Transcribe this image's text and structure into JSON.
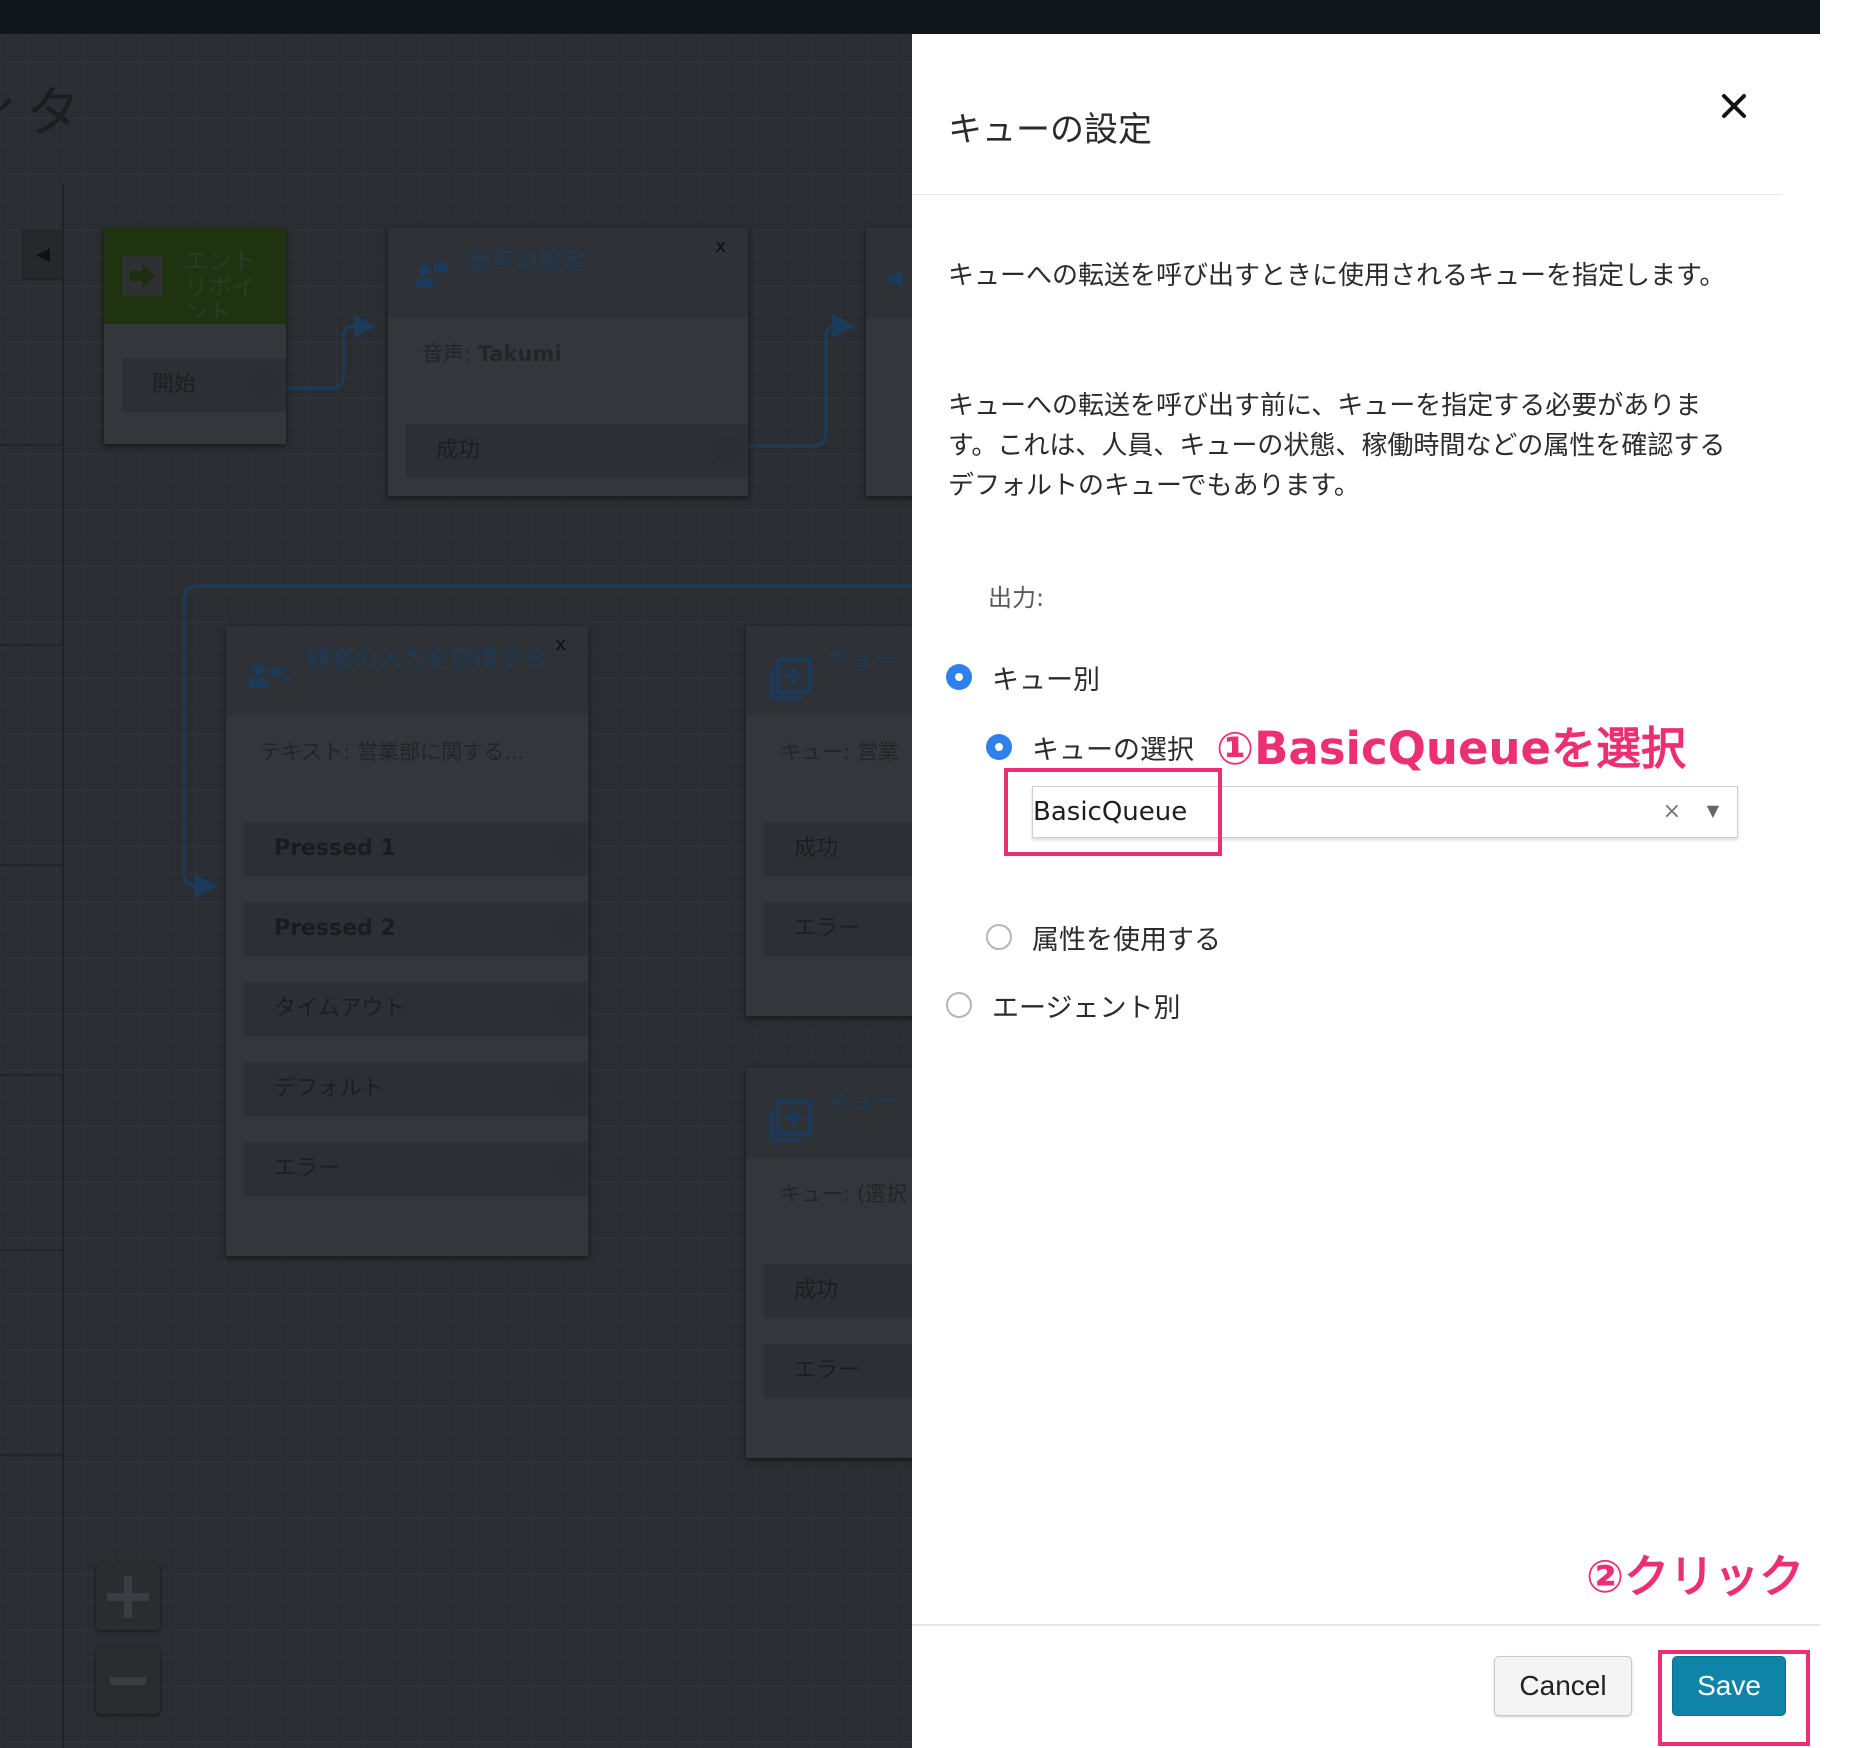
{
  "canvas": {
    "title_fragment": "ィタ",
    "blocks": {
      "entry": {
        "title": "エントリポイント",
        "branch": "開始"
      },
      "voice": {
        "title": "音声の設定",
        "subtitle_key": "音声: ",
        "subtitle_value": "Takumi",
        "branch": "成功",
        "close": "x"
      },
      "input": {
        "title": "顧客の入力を取得する",
        "subtitle": "テキスト: 営業部に関する...",
        "close": "x",
        "branches": [
          "Pressed 1",
          "Pressed 2",
          "タイムアウト",
          "デフォルト",
          "エラー"
        ]
      },
      "queue1": {
        "title": "キュー",
        "subtitle": "キュー: 営業",
        "branches": [
          "成功",
          "エラー"
        ]
      },
      "queue2": {
        "title": "キュー",
        "subtitle": "キュー: (選択",
        "branches": [
          "成功",
          "エラー"
        ]
      }
    }
  },
  "panel": {
    "title": "キューの設定",
    "desc1": "キューへの転送を呼び出すときに使用されるキューを指定します。",
    "desc2": "キューへの転送を呼び出す前に、キューを指定する必要があります。これは、人員、キューの状態、稼働時間などの属性を確認するデフォルトのキューでもあります。",
    "output_label": "出力:",
    "options": {
      "by_queue": "キュー別",
      "select_queue": "キューの選択",
      "use_attribute": "属性を使用する",
      "by_agent": "エージェント別"
    },
    "selected_queue": "BasicQueue",
    "clear_symbol": "×",
    "cancel_label": "Cancel",
    "save_label": "Save"
  },
  "annotations": {
    "step1": "①BasicQueueを選択",
    "step2": "②クリック",
    "color": "#ec2f74"
  }
}
